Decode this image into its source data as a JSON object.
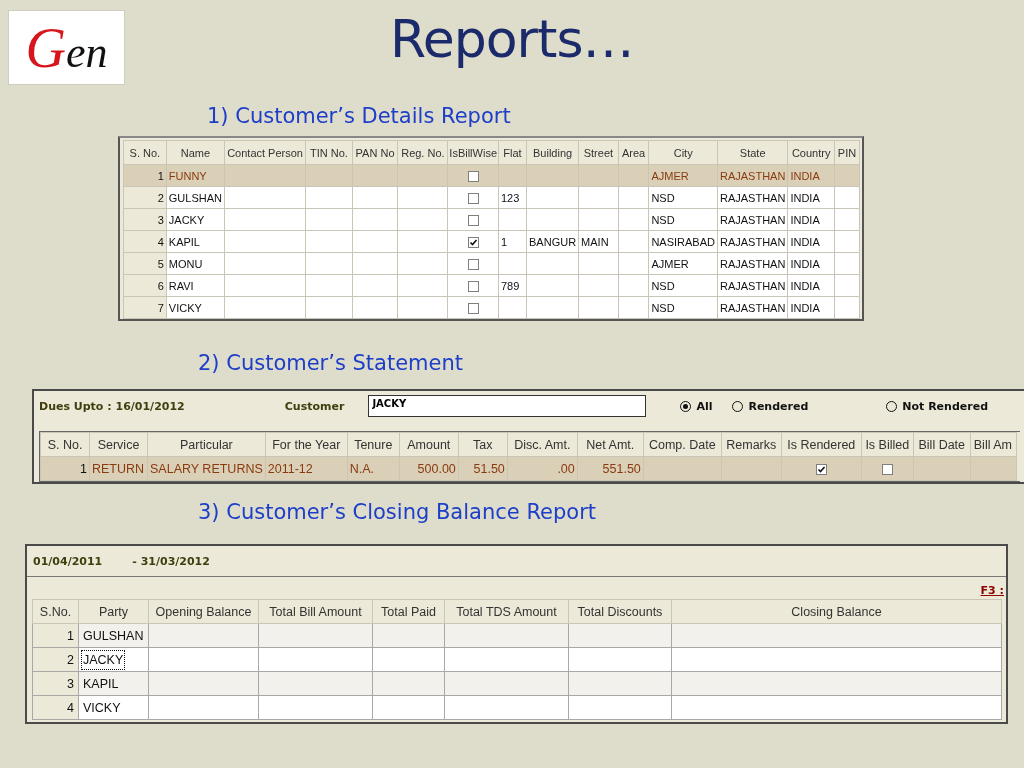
{
  "logo": "Gen",
  "title": "Reports…",
  "details_report": {
    "heading": "1) Customer’s Details Report",
    "columns": [
      {
        "label": "S. No.",
        "kind": "number"
      },
      {
        "label": "Name",
        "kind": "text"
      },
      {
        "label": "Contact Person",
        "kind": "text"
      },
      {
        "label": "TIN No.",
        "kind": "text"
      },
      {
        "label": "PAN No",
        "kind": "text"
      },
      {
        "label": "Reg. No.",
        "kind": "text"
      },
      {
        "label": "IsBillWise",
        "kind": "check"
      },
      {
        "label": "Flat",
        "kind": "text"
      },
      {
        "label": "Building",
        "kind": "text"
      },
      {
        "label": "Street",
        "kind": "text"
      },
      {
        "label": "Area",
        "kind": "text"
      },
      {
        "label": "City",
        "kind": "text"
      },
      {
        "label": "State",
        "kind": "text"
      },
      {
        "label": "Country",
        "kind": "text"
      },
      {
        "label": "PIN",
        "kind": "text"
      }
    ],
    "rows": [
      {
        "selected": true,
        "cells": [
          "1",
          "FUNNY",
          null,
          null,
          null,
          null,
          false,
          null,
          null,
          null,
          null,
          "AJMER",
          "RAJASTHAN",
          "INDIA",
          null
        ]
      },
      {
        "selected": false,
        "cells": [
          "2",
          "GULSHAN",
          null,
          null,
          null,
          null,
          false,
          "123",
          null,
          null,
          null,
          "NSD",
          "RAJASTHAN",
          "INDIA",
          null
        ]
      },
      {
        "selected": false,
        "cells": [
          "3",
          "JACKY",
          null,
          null,
          null,
          null,
          false,
          null,
          null,
          null,
          null,
          "NSD",
          "RAJASTHAN",
          "INDIA",
          null
        ]
      },
      {
        "selected": false,
        "cells": [
          "4",
          "KAPIL",
          null,
          null,
          null,
          null,
          true,
          "1",
          "BANGUR",
          "MAIN",
          null,
          "NASIRABAD",
          "RAJASTHAN",
          "INDIA",
          null
        ]
      },
      {
        "selected": false,
        "cells": [
          "5",
          "MONU",
          null,
          null,
          null,
          null,
          false,
          null,
          null,
          null,
          null,
          "AJMER",
          "RAJASTHAN",
          "INDIA",
          null
        ]
      },
      {
        "selected": false,
        "cells": [
          "6",
          "RAVI",
          null,
          null,
          null,
          null,
          false,
          "789",
          null,
          null,
          null,
          "NSD",
          "RAJASTHAN",
          "INDIA",
          null
        ]
      },
      {
        "selected": false,
        "cells": [
          "7",
          "VICKY",
          null,
          null,
          null,
          null,
          false,
          null,
          null,
          null,
          null,
          "NSD",
          "RAJASTHAN",
          "INDIA",
          null
        ]
      }
    ]
  },
  "statement": {
    "heading": "2) Customer’s Statement",
    "dues_label": "Dues Upto : 16/01/2012",
    "customer_label": "Customer",
    "customer_value": "JACKY",
    "filters": [
      {
        "label": "All",
        "selected": true
      },
      {
        "label": "Rendered",
        "selected": false
      },
      {
        "label": "Not Rendered",
        "selected": false
      }
    ],
    "columns": [
      {
        "label": "S. No.",
        "kind": "number"
      },
      {
        "label": "Service",
        "kind": "text"
      },
      {
        "label": "Particular",
        "kind": "text"
      },
      {
        "label": "For the Year",
        "kind": "text"
      },
      {
        "label": "Tenure",
        "kind": "text"
      },
      {
        "label": "Amount",
        "kind": "number"
      },
      {
        "label": "Tax",
        "kind": "number"
      },
      {
        "label": "Disc. Amt.",
        "kind": "number"
      },
      {
        "label": "Net Amt.",
        "kind": "number"
      },
      {
        "label": "Comp. Date",
        "kind": "text"
      },
      {
        "label": "Remarks",
        "kind": "text"
      },
      {
        "label": "Is Rendered",
        "kind": "check"
      },
      {
        "label": "Is Billed",
        "kind": "check"
      },
      {
        "label": "Bill Date",
        "kind": "text"
      },
      {
        "label": "Bill Am",
        "kind": "text"
      }
    ],
    "rows": [
      {
        "selected": true,
        "cells": [
          "1",
          "RETURN",
          "SALARY RETURNS",
          "2011-12",
          "N.A.",
          "500.00",
          "51.50",
          ".00",
          "551.50",
          null,
          null,
          true,
          false,
          null,
          null
        ]
      }
    ]
  },
  "closing_report": {
    "heading": "3) Customer’s Closing Balance Report",
    "date_from": "01/04/2011",
    "date_to": "-  31/03/2012",
    "shortcut": "F3 :",
    "columns": [
      {
        "label": "S.No.",
        "kind": "number"
      },
      {
        "label": "Party",
        "kind": "text"
      },
      {
        "label": "Opening Balance",
        "kind": "text"
      },
      {
        "label": "Total Bill Amount",
        "kind": "text"
      },
      {
        "label": "Total Paid",
        "kind": "text"
      },
      {
        "label": "Total TDS Amount",
        "kind": "text"
      },
      {
        "label": "Total Discounts",
        "kind": "text"
      },
      {
        "label": "Closing Balance",
        "kind": "text"
      }
    ],
    "rows": [
      {
        "focused": false,
        "cells": [
          "1",
          "GULSHAN",
          null,
          null,
          null,
          null,
          null,
          null
        ]
      },
      {
        "focused": true,
        "cells": [
          "2",
          "JACKY",
          null,
          null,
          null,
          null,
          null,
          null
        ]
      },
      {
        "focused": false,
        "cells": [
          "3",
          "KAPIL",
          null,
          null,
          null,
          null,
          null,
          null
        ]
      },
      {
        "focused": false,
        "cells": [
          "4",
          "VICKY",
          null,
          null,
          null,
          null,
          null,
          null
        ]
      }
    ]
  }
}
